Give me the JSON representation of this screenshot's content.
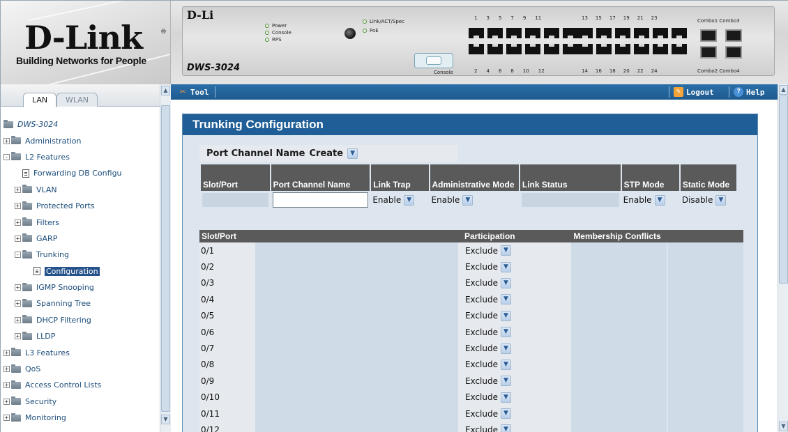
{
  "brand": {
    "name": "D-Link",
    "tagline": "Building Networks for People",
    "reg": "®"
  },
  "device": {
    "brand_small": "D-Li",
    "model": "DWS-3024",
    "leds_left": [
      "Power",
      "Console",
      "RPS"
    ],
    "leds_right": [
      "Link/ACT/Spec",
      "PoE"
    ],
    "console_label": "Console",
    "top_numbers_a": [
      "1",
      "3",
      "5",
      "7",
      "9",
      "11"
    ],
    "bottom_numbers_a": [
      "2",
      "4",
      "6",
      "8",
      "10",
      "12"
    ],
    "top_numbers_b": [
      "13",
      "15",
      "17",
      "19",
      "21",
      "23"
    ],
    "bottom_numbers_b": [
      "14",
      "16",
      "18",
      "20",
      "22",
      "24"
    ],
    "combo_top": "Combo1 Combo3",
    "combo_bottom": "Combo2 Combo4"
  },
  "toolbar": {
    "tool_label": "Tool",
    "logout_label": "Logout",
    "help_label": "Help"
  },
  "nav": {
    "tabs": [
      "LAN",
      "WLAN"
    ],
    "items": [
      {
        "label": "DWS-3024",
        "level": 0,
        "type": "root"
      },
      {
        "label": "Administration",
        "level": 0,
        "type": "folder",
        "expander": "+"
      },
      {
        "label": "L2 Features",
        "level": 0,
        "type": "folder-open",
        "expander": "-"
      },
      {
        "label": "Forwarding DB Configu",
        "level": 1,
        "type": "doc"
      },
      {
        "label": "VLAN",
        "level": 1,
        "type": "folder",
        "expander": "+"
      },
      {
        "label": "Protected Ports",
        "level": 1,
        "type": "folder",
        "expander": "+"
      },
      {
        "label": "Filters",
        "level": 1,
        "type": "folder",
        "expander": "+"
      },
      {
        "label": "GARP",
        "level": 1,
        "type": "folder",
        "expander": "+"
      },
      {
        "label": "Trunking",
        "level": 1,
        "type": "folder-open",
        "expander": "-"
      },
      {
        "label": "Configuration",
        "level": 2,
        "type": "doc",
        "selected": true
      },
      {
        "label": "IGMP Snooping",
        "level": 1,
        "type": "folder",
        "expander": "+"
      },
      {
        "label": "Spanning Tree",
        "level": 1,
        "type": "folder",
        "expander": "+"
      },
      {
        "label": "DHCP Filtering",
        "level": 1,
        "type": "folder",
        "expander": "+"
      },
      {
        "label": "LLDP",
        "level": 1,
        "type": "folder",
        "expander": "+"
      },
      {
        "label": "L3 Features",
        "level": 0,
        "type": "folder",
        "expander": "+"
      },
      {
        "label": "QoS",
        "level": 0,
        "type": "folder",
        "expander": "+"
      },
      {
        "label": "Access Control Lists",
        "level": 0,
        "type": "folder",
        "expander": "+"
      },
      {
        "label": "Security",
        "level": 0,
        "type": "folder",
        "expander": "+"
      },
      {
        "label": "Monitoring",
        "level": 0,
        "type": "folder",
        "expander": "+"
      }
    ]
  },
  "page": {
    "title": "Trunking Configuration",
    "pcn_label": "Port Channel Name",
    "pcn_value": "Create",
    "config_headers": [
      "Slot/Port",
      "Port Channel Name",
      "Link Trap",
      "Administrative Mode",
      "Link Status",
      "STP Mode",
      "Static Mode"
    ],
    "config_values": {
      "port_channel_name": "",
      "link_trap": "Enable",
      "admin_mode": "Enable",
      "stp_mode": "Enable",
      "static_mode": "Disable"
    },
    "ports_headers": [
      "Slot/Port",
      "Participation",
      "Membership Conflicts"
    ],
    "ports": [
      {
        "slot": "0/1",
        "participation": "Exclude"
      },
      {
        "slot": "0/2",
        "participation": "Exclude"
      },
      {
        "slot": "0/3",
        "participation": "Exclude"
      },
      {
        "slot": "0/4",
        "participation": "Exclude"
      },
      {
        "slot": "0/5",
        "participation": "Exclude"
      },
      {
        "slot": "0/6",
        "participation": "Exclude"
      },
      {
        "slot": "0/7",
        "participation": "Exclude"
      },
      {
        "slot": "0/8",
        "participation": "Exclude"
      },
      {
        "slot": "0/9",
        "participation": "Exclude"
      },
      {
        "slot": "0/10",
        "participation": "Exclude"
      },
      {
        "slot": "0/11",
        "participation": "Exclude"
      },
      {
        "slot": "0/12",
        "participation": "Exclude"
      }
    ]
  },
  "colors": {
    "toolbar": "#1d5a8f",
    "panel_title": "#1f5e96",
    "header_cell": "#5a5a5a",
    "selected": "#25528a"
  }
}
